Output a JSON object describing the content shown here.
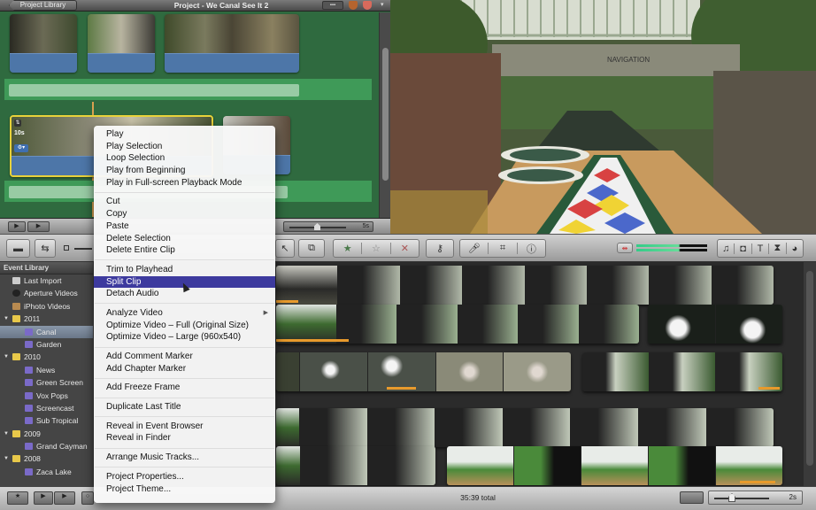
{
  "project": {
    "library_button": "Project Library",
    "title": "Project - We Canal See It 2",
    "view_button": "▪▪▪",
    "selected_clip_duration": "10s",
    "zoom_label": "5s"
  },
  "viewer": {
    "sign_text": "NAVIGATION"
  },
  "toolbar": {
    "left_buttons": [
      "camera-import",
      "swap"
    ],
    "center_buttons": [
      "select",
      "add-to-project",
      "favorite",
      "unmark",
      "reject",
      "keyword",
      "voiceover",
      "crop",
      "inspector"
    ],
    "right_buttons": [
      "music",
      "photo",
      "title",
      "transition",
      "map"
    ]
  },
  "event_library": {
    "header": "Event Library",
    "items": [
      {
        "label": "Last Import",
        "level": 1,
        "icon": "import-icon"
      },
      {
        "label": "Aperture Videos",
        "level": 1,
        "icon": "aperture-icon"
      },
      {
        "label": "iPhoto Videos",
        "level": 1,
        "icon": "iphoto-icon"
      },
      {
        "label": "2011",
        "level": 0,
        "icon": "year-folder-icon"
      },
      {
        "label": "Canal",
        "level": 2,
        "icon": "event-icon",
        "selected": true
      },
      {
        "label": "Garden",
        "level": 2,
        "icon": "event-icon"
      },
      {
        "label": "2010",
        "level": 0,
        "icon": "year-folder-icon"
      },
      {
        "label": "News",
        "level": 2,
        "icon": "event-icon"
      },
      {
        "label": "Green Screen",
        "level": 2,
        "icon": "event-icon"
      },
      {
        "label": "Vox Pops",
        "level": 2,
        "icon": "event-icon"
      },
      {
        "label": "Screencast",
        "level": 2,
        "icon": "event-icon"
      },
      {
        "label": "Sub Tropical",
        "level": 2,
        "icon": "event-icon"
      },
      {
        "label": "2009",
        "level": 0,
        "icon": "year-folder-icon"
      },
      {
        "label": "Grand Cayman",
        "level": 2,
        "icon": "event-icon"
      },
      {
        "label": "2008",
        "level": 0,
        "icon": "year-folder-icon"
      },
      {
        "label": "Zaca Lake",
        "level": 2,
        "icon": "event-icon"
      }
    ]
  },
  "context_menu": {
    "groups": [
      [
        "Play",
        "Play Selection",
        "Loop Selection",
        "Play from Beginning",
        "Play in Full-screen Playback Mode"
      ],
      [
        "Cut",
        "Copy",
        "Paste",
        "Delete Selection",
        "Delete Entire Clip"
      ],
      [
        "Trim to Playhead",
        "Split Clip",
        "Detach Audio"
      ],
      [
        "Analyze Video",
        "Optimize Video – Full (Original Size)",
        "Optimize Video – Large (960x540)"
      ],
      [
        "Add Comment Marker",
        "Add Chapter Marker"
      ],
      [
        "Add Freeze Frame"
      ],
      [
        "Duplicate Last Title"
      ],
      [
        "Reveal in Event Browser",
        "Reveal in Finder"
      ],
      [
        "Arrange Music Tracks..."
      ],
      [
        "Project Properties...",
        "Project Theme..."
      ]
    ],
    "highlighted": "Split Clip",
    "submenu_item": "Analyze Video"
  },
  "bottom_bar": {
    "total": "35:39 total",
    "zoom_label": "2s"
  },
  "colors": {
    "project_bg": "#2f6a3f",
    "menu_highlight": "#3d3a9e",
    "selection_yellow": "#e8d23a",
    "used_marker": "#e89a2c"
  }
}
